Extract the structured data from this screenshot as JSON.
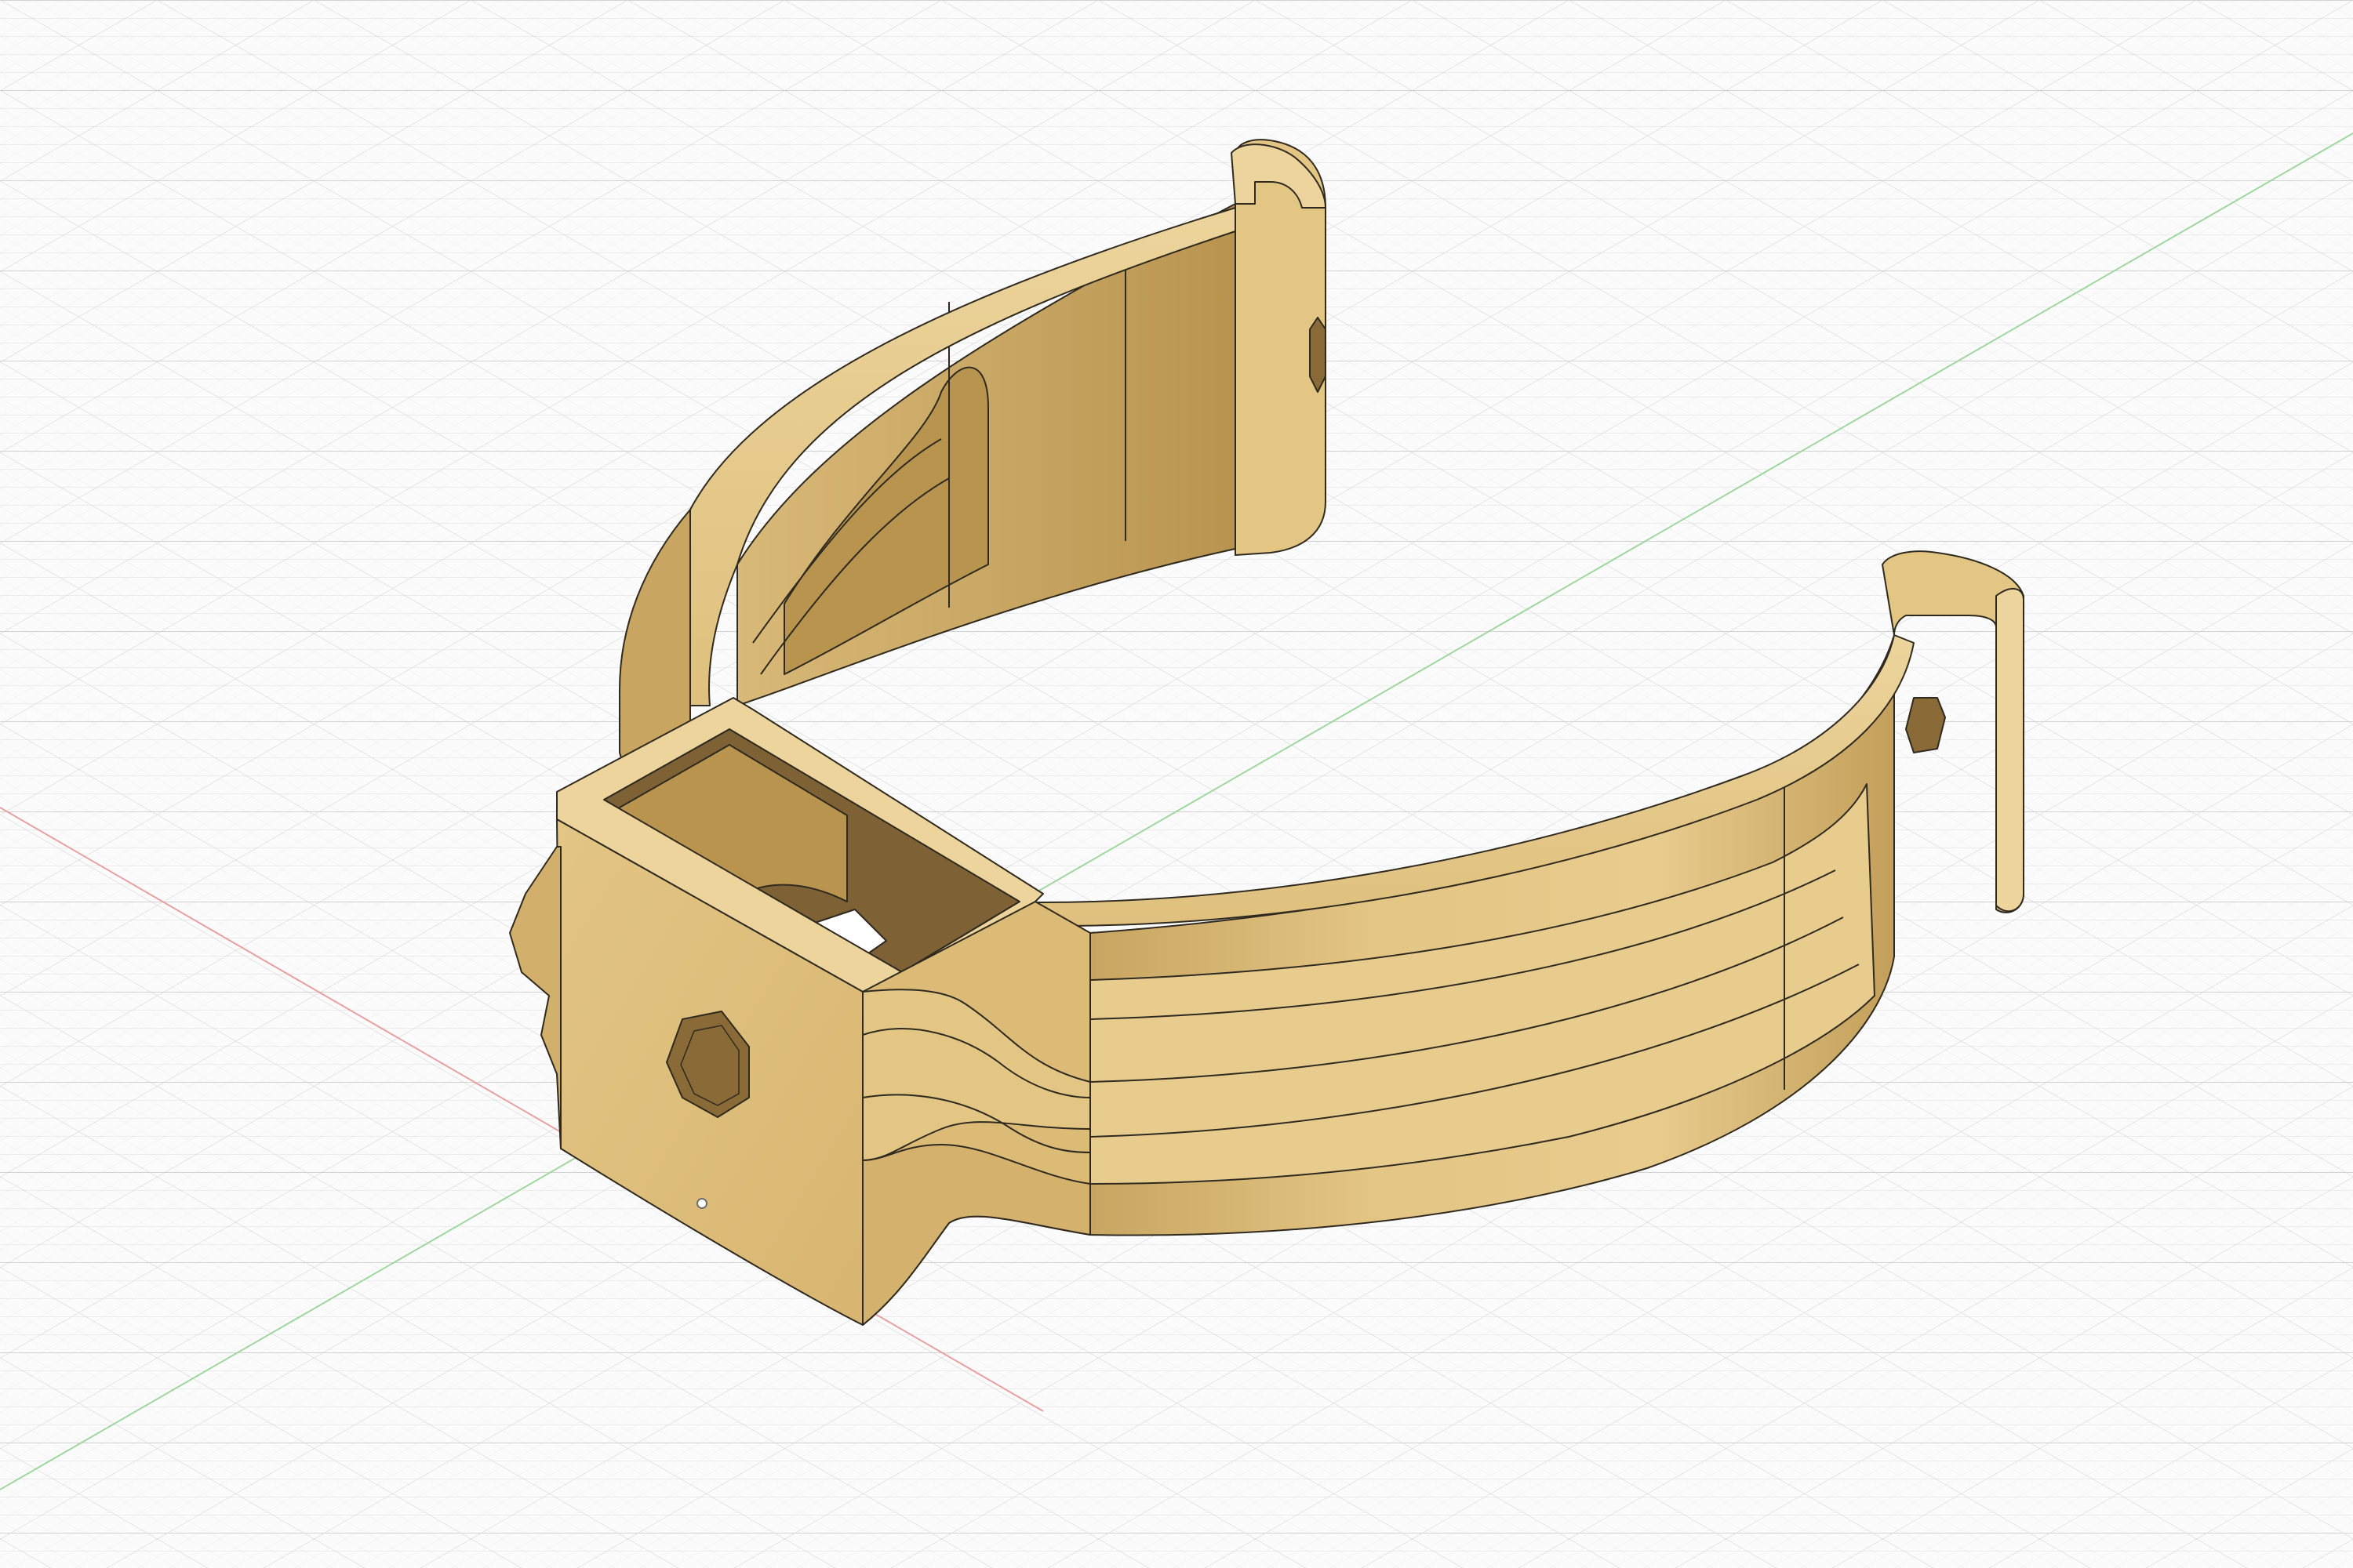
{
  "viewport": {
    "view": "isometric-3d-model-canvas",
    "background": "#fbfbfb",
    "grid": {
      "shown": true,
      "minor_line_color": "#e4e4e4",
      "major_line_color": "#d2d2d2",
      "x_axis_color": "#e8a0a0",
      "y_axis_color": "#9fd79f"
    }
  },
  "model": {
    "name": "pipe-clamp-bracket",
    "body_color": "#e3c584",
    "highlight_color": "#ecd49c",
    "shadow_color": "#c8a561",
    "deep_shadow_color": "#a8854a",
    "edge_color": "#2f2a1f",
    "features": [
      "split-ring-clamp",
      "flared-clip-tips",
      "square-boss-mount",
      "hex-nut-pocket",
      "hex-bolt-holes",
      "reinforcing-rib"
    ]
  }
}
